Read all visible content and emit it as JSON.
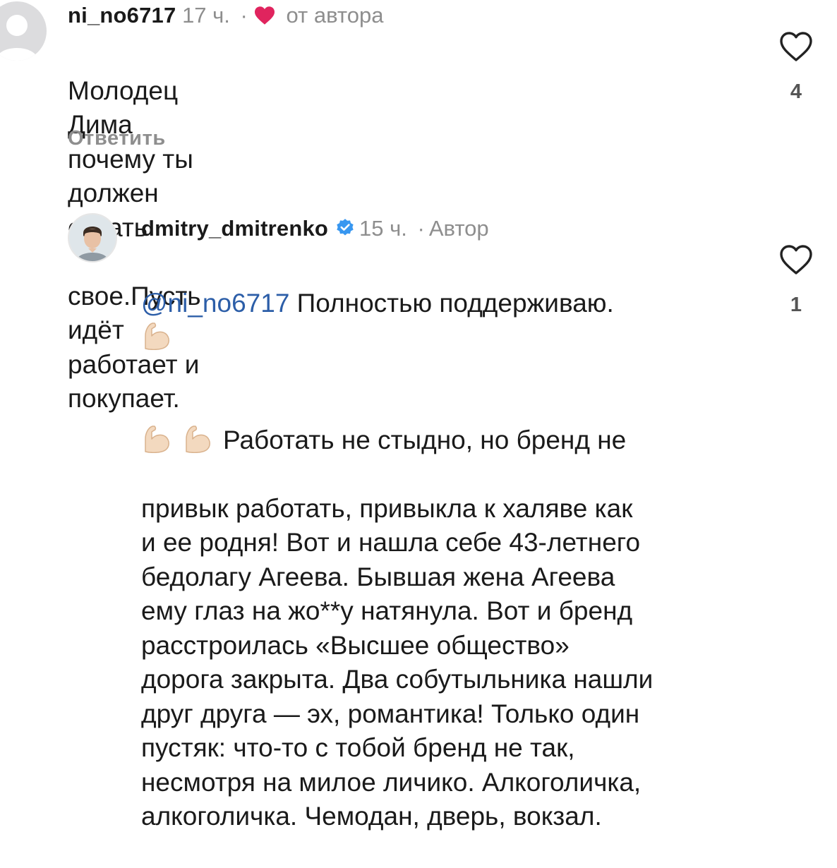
{
  "comments": [
    {
      "username": "ni_no6717",
      "time": "17 ч.",
      "separator": "·",
      "author_like_label": "от автора",
      "text_line1": "Молодец  Дима  почему ты должен отдать",
      "text_line2": "свое.Пусть идёт работает  и покупает.",
      "reply_label": "Ответить",
      "like_count": "4",
      "icons": [
        "avatar-placeholder-icon",
        "heart-filled-icon",
        "heart-outline-icon"
      ],
      "accent_color": "#e0245e"
    },
    {
      "username": "dmitry_dmitrenko",
      "time": "15 ч.",
      "separator": "·",
      "badge_label": "Автор",
      "mention": "@ni_no6717",
      "text_lead": " Полностью поддерживаю.",
      "text_after_emoji": "Работать не стыдно, но бренд не",
      "text_rest": "привык работать, привыкла к халяве как\nи ее родня! Вот и нашла себе 43-летнего\nбедолагу Агеева. Бывшая жена Агеева\nему глаз на жо**у натянула. Вот и бренд\nрасстроилась «Высшее общество»\nдорога закрыта. Два собутыльника нашли\nдруг друга — эх, романтика! Только один\nпустяк: что-то с тобой бренд не так,\nнесмотря на милое личико. Алкоголичка,\nалкоголичка. Чемодан, дверь, вокзал.",
      "like_count": "1",
      "icons": [
        "verified-badge-icon",
        "flexed-biceps-icon",
        "heart-outline-icon"
      ],
      "mention_color": "#2c5ea8"
    }
  ]
}
